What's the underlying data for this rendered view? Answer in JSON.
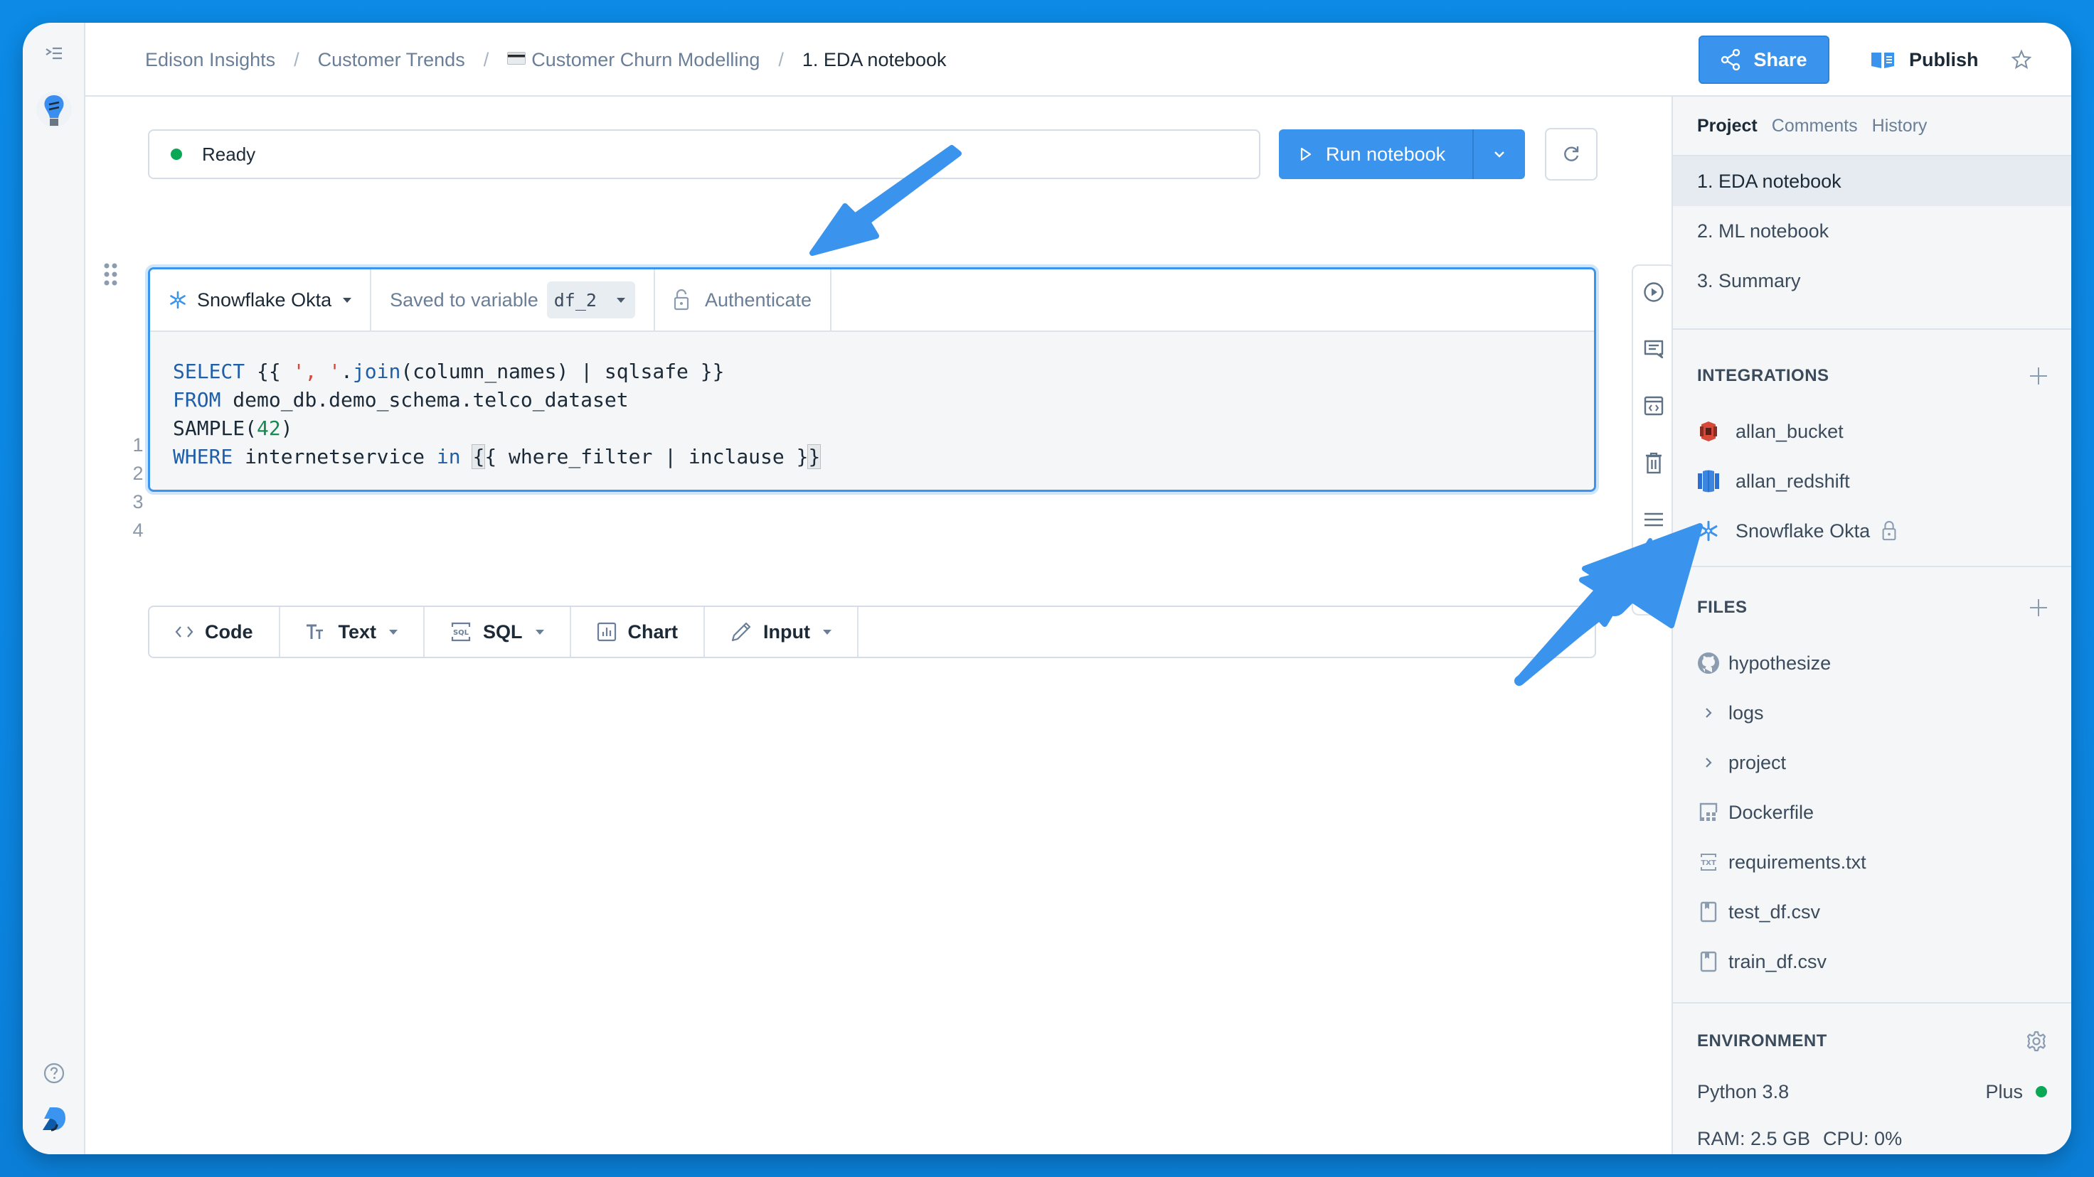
{
  "breadcrumb": [
    {
      "label": "Edison Insights"
    },
    {
      "label": "Customer Trends"
    },
    {
      "label": "Customer Churn Modelling",
      "icon": "credit-card-icon"
    },
    {
      "label": "1. EDA notebook",
      "current": true
    }
  ],
  "breadcrumb_separator": "/",
  "header": {
    "share_label": "Share",
    "publish_label": "Publish"
  },
  "status": {
    "text": "Ready",
    "color": "#0aa854"
  },
  "toolbar": {
    "run_label": "Run notebook"
  },
  "cell": {
    "connection": "Snowflake Okta",
    "saved_to_label": "Saved to variable",
    "variable": "df_2",
    "authenticate_label": "Authenticate",
    "line_numbers": [
      "1",
      "2",
      "3",
      "4"
    ],
    "code": {
      "l1_kw": "SELECT",
      "l1_a": " {{ ",
      "l1_str1": "'",
      "l1_str2": ", ",
      "l1_str3": "'",
      "l1_b": ".",
      "l1_fn": "join",
      "l1_c": "(column_names) | sqlsafe }}",
      "l2_kw": "FROM",
      "l2_a": " demo_db.demo_schema.telco_dataset",
      "l3_a": "SAMPLE(",
      "l3_num": "42",
      "l3_b": ")",
      "l4_kw": "WHERE",
      "l4_a": " internetservice ",
      "l4_kw2": "in",
      "l4_sp": " ",
      "l4_br1": "{",
      "l4_b": "{ where_filter | inclause }",
      "l4_br2": "}"
    }
  },
  "add_cell_bar": [
    {
      "label": "Code",
      "icon": "code-icon",
      "dropdown": false
    },
    {
      "label": "Text",
      "icon": "text-icon",
      "dropdown": true
    },
    {
      "label": "SQL",
      "icon": "sql-icon",
      "dropdown": true
    },
    {
      "label": "Chart",
      "icon": "chart-icon",
      "dropdown": false
    },
    {
      "label": "Input",
      "icon": "pencil-icon",
      "dropdown": true
    }
  ],
  "panel": {
    "tabs": [
      "Project",
      "Comments",
      "History"
    ],
    "active_tab": "Project",
    "notebooks": [
      "1. EDA notebook",
      "2. ML notebook",
      "3. Summary"
    ],
    "integrations_title": "INTEGRATIONS",
    "integrations": [
      {
        "label": "allan_bucket",
        "icon": "s3-bucket-icon"
      },
      {
        "label": "allan_redshift",
        "icon": "redshift-icon"
      },
      {
        "label": "Snowflake Okta",
        "icon": "snowflake-icon",
        "locked": true
      }
    ],
    "files_title": "FILES",
    "files": [
      {
        "label": "hypothesize",
        "icon": "github-icon"
      },
      {
        "label": "logs",
        "icon": "chevron-right-icon"
      },
      {
        "label": "project",
        "icon": "chevron-right-icon"
      },
      {
        "label": "Dockerfile",
        "icon": "docker-file-icon"
      },
      {
        "label": "requirements.txt",
        "icon": "txt-file-icon"
      },
      {
        "label": "test_df.csv",
        "icon": "csv-file-icon"
      },
      {
        "label": "train_df.csv",
        "icon": "csv-file-icon"
      }
    ],
    "environment_title": "ENVIRONMENT",
    "python": "Python 3.8",
    "tier": "Plus",
    "tier_status_color": "#0aa854",
    "ram": "RAM: 2.5 GB",
    "cpu": "CPU: 0%"
  },
  "colors": {
    "accent": "#3a93ec",
    "background": "#0c8ae6",
    "annotation_arrow": "#3a93ec"
  }
}
